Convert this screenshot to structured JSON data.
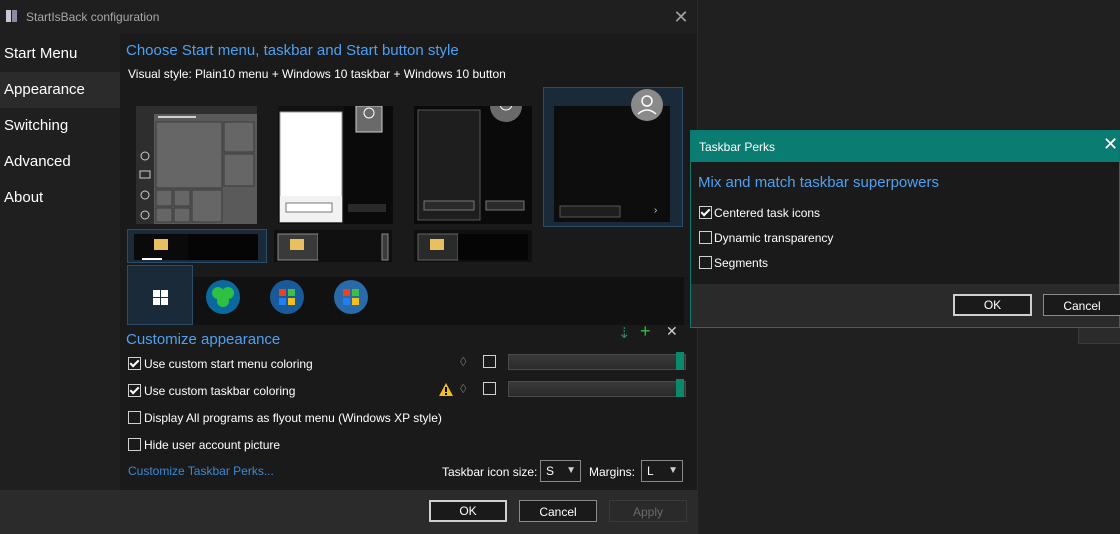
{
  "main_window": {
    "title": "StartIsBack configuration",
    "close_label": "✕"
  },
  "sidebar": {
    "items": [
      {
        "label": "Start Menu"
      },
      {
        "label": "Appearance"
      },
      {
        "label": "Switching"
      },
      {
        "label": "Advanced"
      },
      {
        "label": "About"
      }
    ]
  },
  "style_section": {
    "title": "Choose Start menu, taskbar and Start button style",
    "visual_style_label": "Visual style:",
    "visual_style_value": "Plain10 menu + Windows 10 taskbar + Windows 10 button"
  },
  "customize": {
    "title": "Customize appearance",
    "options": [
      {
        "label": "Use custom start menu coloring",
        "checked": true
      },
      {
        "label": "Use custom taskbar coloring",
        "checked": true
      },
      {
        "label": "Display All programs as flyout menu (Windows XP style)",
        "checked": false
      },
      {
        "label": "Hide user account picture",
        "checked": false
      }
    ],
    "perks_link": "Customize Taskbar Perks...",
    "icon_size_label": "Taskbar icon size:",
    "icon_size_value": "S",
    "margins_label": "Margins:",
    "margins_value": "L"
  },
  "footer": {
    "ok": "OK",
    "cancel": "Cancel",
    "apply": "Apply"
  },
  "perks_window": {
    "title": "Taskbar Perks",
    "heading": "Mix and match taskbar superpowers",
    "options": [
      {
        "label": "Centered task icons",
        "checked": true
      },
      {
        "label": "Dynamic transparency",
        "checked": false
      },
      {
        "label": "Segments",
        "checked": false
      }
    ],
    "ok": "OK",
    "cancel": "Cancel"
  },
  "colors": {
    "accent_blue": "#4fa0f0",
    "perks_titlebar": "#0a7c72",
    "slider_thumb": "#0a8a6a",
    "warning": "#f0c020"
  }
}
